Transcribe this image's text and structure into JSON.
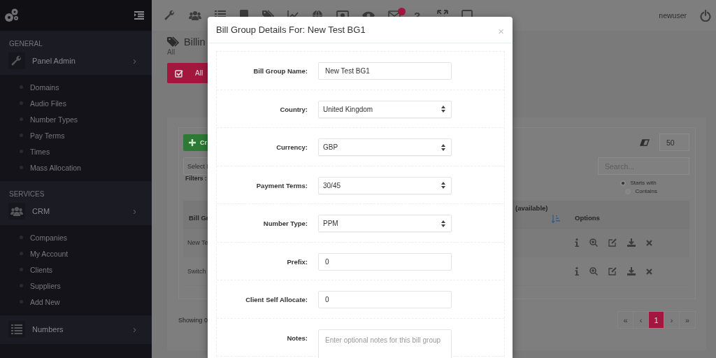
{
  "sidebar": {
    "menus": [
      {
        "heading": "GENERAL",
        "label": "Panel Admin",
        "chevron": "›",
        "children": [
          {
            "label": "Domains"
          },
          {
            "label": "Audio Files"
          },
          {
            "label": "Number Types"
          },
          {
            "label": "Pay Terms"
          },
          {
            "label": "Times"
          },
          {
            "label": "Mass Allocation"
          }
        ]
      },
      {
        "heading": "SERVICES",
        "label": "CRM",
        "chevron": "›",
        "children": [
          {
            "label": "Companies"
          },
          {
            "label": "My Account"
          },
          {
            "label": "Clients"
          },
          {
            "label": "Suppliers"
          },
          {
            "label": "Add New"
          }
        ]
      },
      {
        "label": "Numbers",
        "chevron": "›"
      }
    ]
  },
  "topbar": {
    "help": "?",
    "user": "newuser"
  },
  "page": {
    "title": "Billin",
    "subtitle": "All",
    "filter_button": "All",
    "create_button": "Cr",
    "page_size": "50",
    "select_placeholder": "Select I",
    "filters_label": "Filters :",
    "search_placeholder": "Search...",
    "match_options": [
      {
        "label": "Starts with",
        "selected": true
      },
      {
        "label": "Contains",
        "selected": false
      }
    ],
    "table": {
      "columns": [
        "Bill Gr",
        "(available)",
        "Options"
      ],
      "rows": [
        {
          "cells": [
            "New Te"
          ]
        },
        {
          "cells": [
            "Switch"
          ]
        }
      ]
    },
    "status": "Showing 0",
    "pagination": [
      {
        "label": "«",
        "selected": false
      },
      {
        "label": "‹",
        "selected": false
      },
      {
        "label": "1",
        "selected": true
      },
      {
        "label": "›",
        "selected": false
      },
      {
        "label": "»",
        "selected": false
      }
    ]
  },
  "modal": {
    "title": "Bill Group Details For: New Test BG1",
    "close": "×",
    "fields": [
      {
        "label": "Bill Group Name:",
        "kind": "text",
        "value": "New Test BG1"
      },
      {
        "label": "Country:",
        "kind": "select",
        "value": "United Kingdom"
      },
      {
        "label": "Currency:",
        "kind": "select",
        "value": "GBP"
      },
      {
        "label": "Payment Terms:",
        "kind": "select",
        "value": "30/45"
      },
      {
        "label": "Number Type:",
        "kind": "select",
        "value": "PPM"
      },
      {
        "label": "Prefix:",
        "kind": "text",
        "value": "0"
      },
      {
        "label": "Client Self Allocate:",
        "kind": "text",
        "value": "0"
      },
      {
        "label": "Notes:",
        "kind": "textarea",
        "placeholder": "Enter optional notes for this bill group"
      }
    ]
  }
}
